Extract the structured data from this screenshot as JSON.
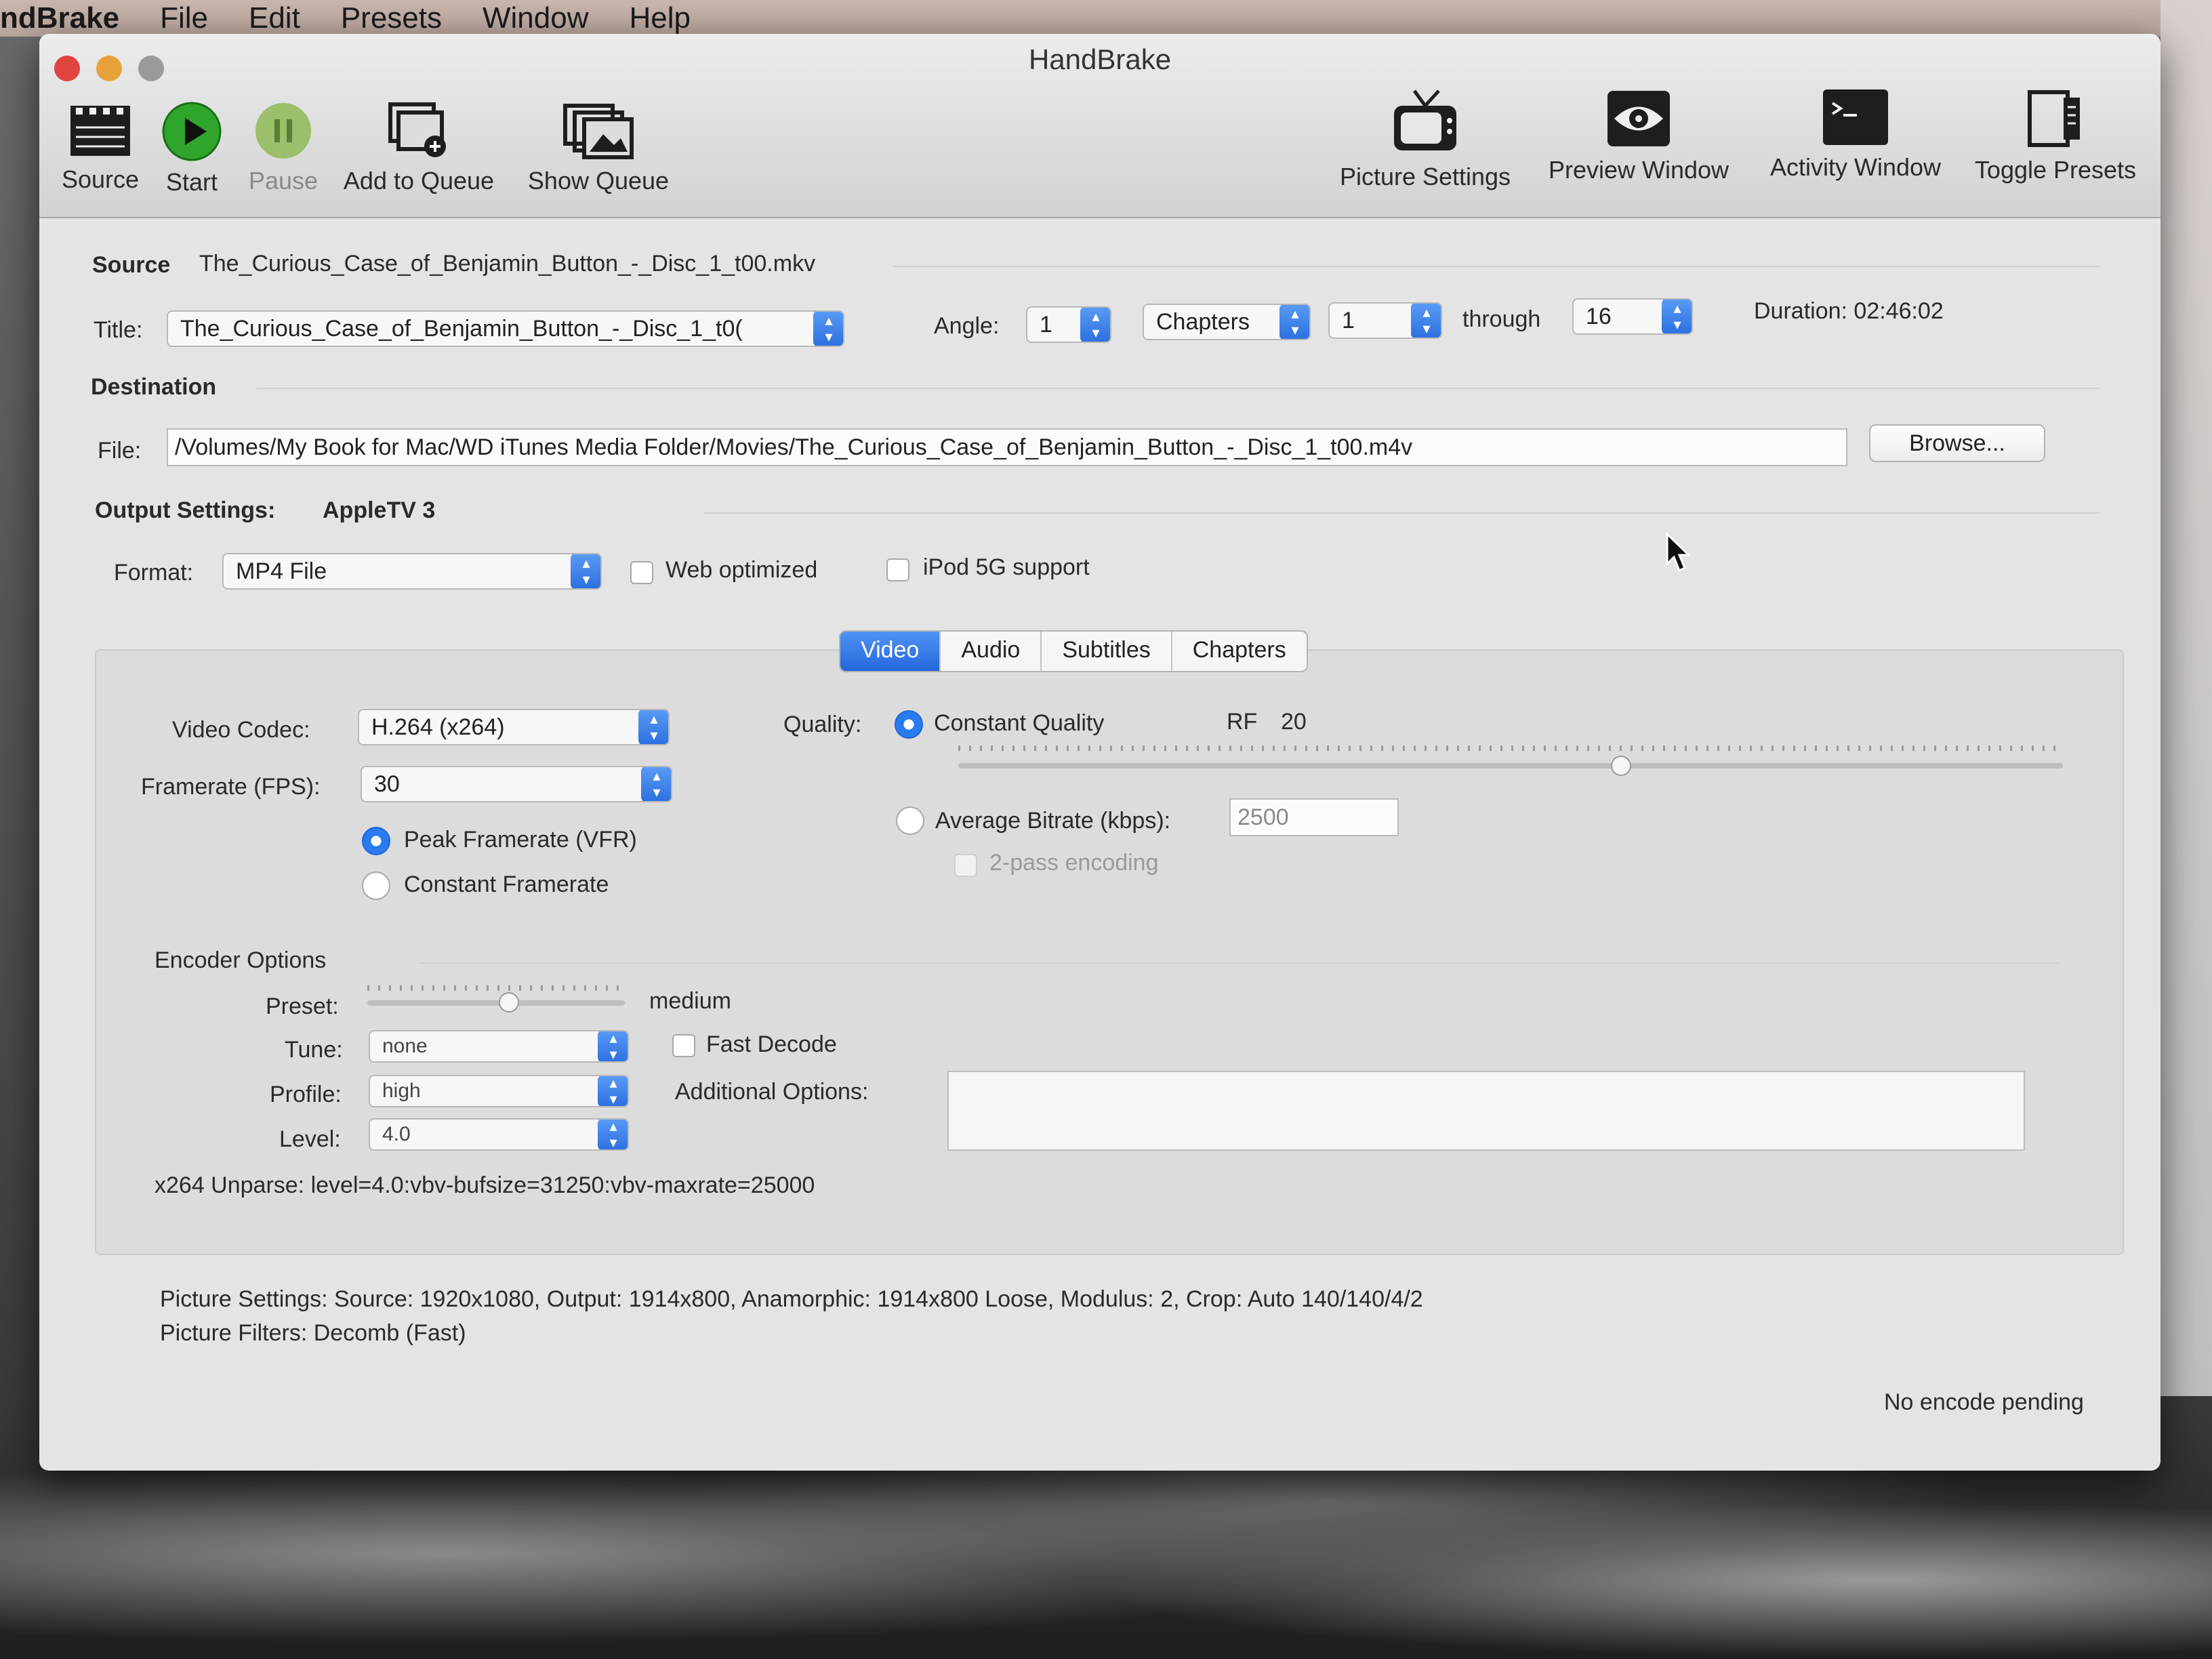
{
  "menubar": {
    "app": "ndBrake",
    "items": [
      "File",
      "Edit",
      "Presets",
      "Window",
      "Help"
    ]
  },
  "window": {
    "title": "HandBrake"
  },
  "toolbar": {
    "source": "Source",
    "start": "Start",
    "pause": "Pause",
    "add_to_queue": "Add to Queue",
    "show_queue": "Show Queue",
    "picture_settings": "Picture Settings",
    "preview_window": "Preview Window",
    "activity_window": "Activity Window",
    "toggle_presets": "Toggle Presets"
  },
  "source": {
    "label": "Source",
    "value": "The_Curious_Case_of_Benjamin_Button_-_Disc_1_t00.mkv",
    "title_label": "Title:",
    "title_value": "The_Curious_Case_of_Benjamin_Button_-_Disc_1_t0(",
    "angle_label": "Angle:",
    "angle_value": "1",
    "range_type": "Chapters",
    "range_start": "1",
    "through": "through",
    "range_end": "16",
    "duration": "Duration: 02:46:02"
  },
  "destination": {
    "label": "Destination",
    "file_label": "File:",
    "file_value": "/Volumes/My Book for Mac/WD iTunes Media Folder/Movies/The_Curious_Case_of_Benjamin_Button_-_Disc_1_t00.m4v",
    "browse": "Browse..."
  },
  "output": {
    "label": "Output Settings:",
    "preset": "AppleTV 3",
    "format_label": "Format:",
    "format_value": "MP4 File",
    "web_optimized": "Web optimized",
    "ipod_support": "iPod 5G support"
  },
  "tabs": [
    "Video",
    "Audio",
    "Subtitles",
    "Chapters"
  ],
  "video": {
    "codec_label": "Video Codec:",
    "codec_value": "H.264 (x264)",
    "fps_label": "Framerate (FPS):",
    "fps_value": "30",
    "peak_framerate": "Peak Framerate (VFR)",
    "constant_framerate": "Constant Framerate",
    "quality_label": "Quality:",
    "constant_quality": "Constant Quality",
    "rf_label": "RF",
    "rf_value": "20",
    "quality_slider_level": 0.6,
    "average_bitrate": "Average Bitrate (kbps):",
    "bitrate_value": "2500",
    "two_pass": "2-pass encoding"
  },
  "encoder": {
    "section": "Encoder Options",
    "preset_label": "Preset:",
    "preset_value": "medium",
    "preset_slider_level": 0.55,
    "tune_label": "Tune:",
    "tune_value": "none",
    "fast_decode": "Fast Decode",
    "profile_label": "Profile:",
    "profile_value": "high",
    "additional_label": "Additional Options:",
    "level_label": "Level:",
    "level_value": "4.0",
    "unparse": "x264 Unparse: level=4.0:vbv-bufsize=31250:vbv-maxrate=25000"
  },
  "summary": {
    "picture_settings": "Picture Settings: Source: 1920x1080, Output: 1914x800, Anamorphic: 1914x800 Loose, Modulus: 2, Crop: Auto 140/140/4/2",
    "picture_filters": "Picture Filters: Decomb (Fast)"
  },
  "status": "No encode pending"
}
